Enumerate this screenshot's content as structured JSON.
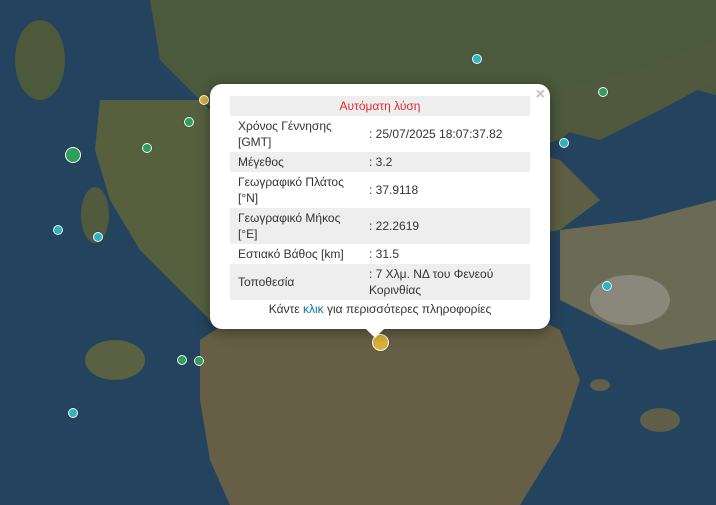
{
  "popup": {
    "title": "Αυτόματη λύση",
    "close_symbol": "×",
    "rows": [
      {
        "label": "Χρόνος Γέννησης [GMT]",
        "value": ": 25/07/2025 18:07:37.82"
      },
      {
        "label": "Μέγεθος",
        "value": ": 3.2"
      },
      {
        "label": "Γεωγραφικό Πλάτος [°N]",
        "value": ": 37.9118"
      },
      {
        "label": "Γεωγραφικό Μήκος [°E]",
        "value": ": 22.2619"
      },
      {
        "label": "Εστιακό Βάθος [km]",
        "value": ": 31.5"
      },
      {
        "label": "Τοποθεσία",
        "value": ": 7 Χλμ. ΝΔ του Φενεού Κορινθίας"
      }
    ],
    "footer_prefix": "Κάντε",
    "footer_link": "κλικ",
    "footer_suffix": "για περισσότερες πληροφορίες"
  },
  "colors": {
    "recent_quake": "#d9b237",
    "older_quake": "#2e9e5b",
    "oldest_quake": "#2bb5c2",
    "popup_title": "#e32b2b",
    "link": "#0078a8"
  }
}
